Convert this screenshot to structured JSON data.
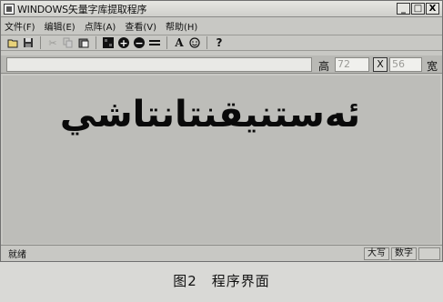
{
  "window": {
    "title": "WINDOWS矢量字库提取程序",
    "controls": {
      "minimize": "_",
      "maximize": "□",
      "close": "X"
    }
  },
  "menu": [
    {
      "label": "文件(F)"
    },
    {
      "label": "编辑(E)"
    },
    {
      "label": "点阵(A)"
    },
    {
      "label": "查看(V)"
    },
    {
      "label": "帮助(H)"
    }
  ],
  "toolbar": {
    "icons": [
      "open-icon",
      "save-icon",
      "cut-icon",
      "copy-icon",
      "paste-icon",
      "fill-icon",
      "zoom-in-icon",
      "zoom-out-icon",
      "equal-icon",
      "font-icon",
      "smile-icon",
      "help-icon"
    ],
    "zoom_in": "+",
    "zoom_out": "−",
    "help": "?",
    "font": "A"
  },
  "params": {
    "height_label": "高",
    "height_value": "72",
    "x_label": "X",
    "width_value": "56",
    "width_label": "宽"
  },
  "canvas": {
    "text": "ئەستنيقنتانتاشي"
  },
  "status": {
    "ready": "就绪",
    "caps": "大写",
    "num": "数字"
  },
  "caption": "图2　程序界面"
}
